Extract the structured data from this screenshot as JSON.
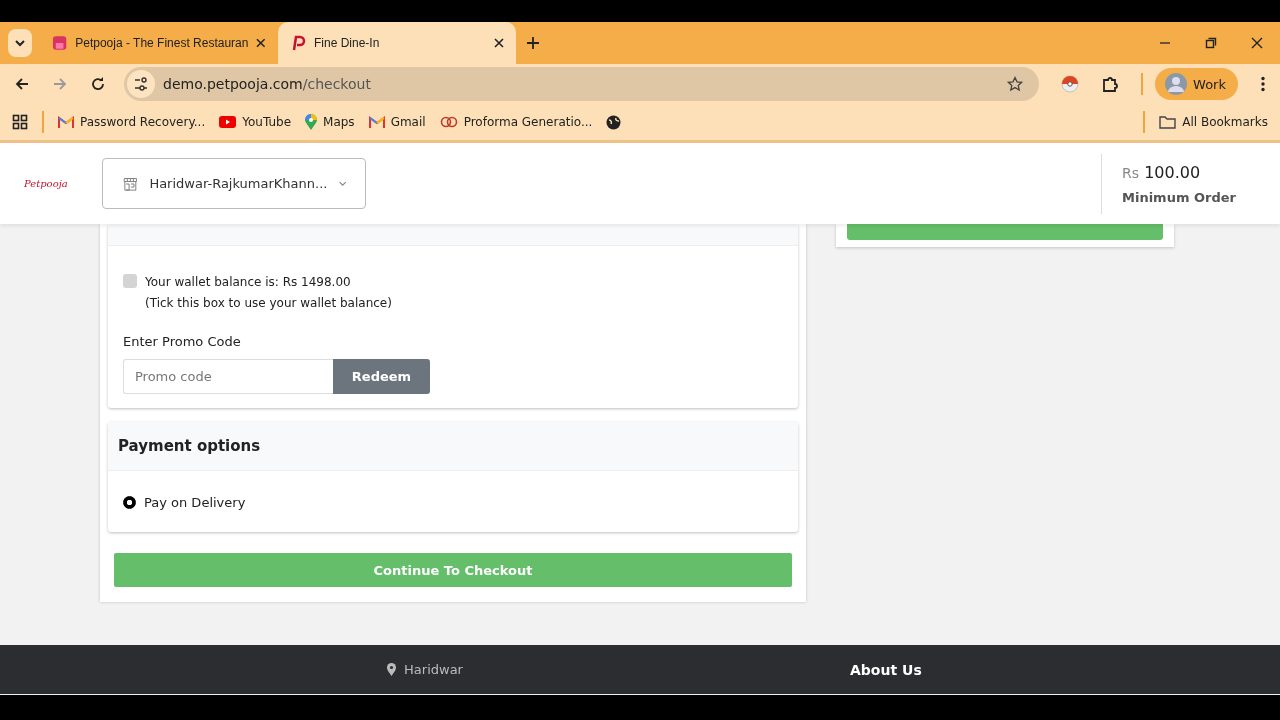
{
  "browser": {
    "tabs": [
      {
        "title": "Petpooja - The Finest Restauran",
        "selected": false
      },
      {
        "title": "Fine Dine-In",
        "selected": true
      }
    ],
    "url": {
      "host": "demo.petpooja.com",
      "path": "/checkout"
    },
    "profile": "Work",
    "bookmarks": [
      {
        "label": "Password Recovery...",
        "kind": "gmail"
      },
      {
        "label": "YouTube",
        "kind": "youtube"
      },
      {
        "label": "Maps",
        "kind": "maps"
      },
      {
        "label": "Gmail",
        "kind": "gmail"
      },
      {
        "label": "Proforma Generatio...",
        "kind": "link"
      },
      {
        "kind": "globe"
      }
    ],
    "all_bookmarks": "All Bookmarks"
  },
  "header": {
    "logo": "Petpooja",
    "outlet": "Haridwar-RajkumarKhann...",
    "currency": "Rs",
    "min_amount": "100.00",
    "min_label": "Minimum Order"
  },
  "wallet": {
    "checked": false,
    "balance": "Your wallet balance is: Rs 1498.00",
    "hint": "(Tick this box to use your wallet balance)",
    "promo_label": "Enter Promo Code",
    "promo_placeholder": "Promo code",
    "redeem": "Redeem"
  },
  "payment": {
    "title": "Payment options",
    "options": [
      {
        "label": "Pay on Delivery",
        "selected": true
      }
    ]
  },
  "checkout": "Continue To Checkout",
  "footer": {
    "location": "Haridwar",
    "about": "About Us"
  }
}
